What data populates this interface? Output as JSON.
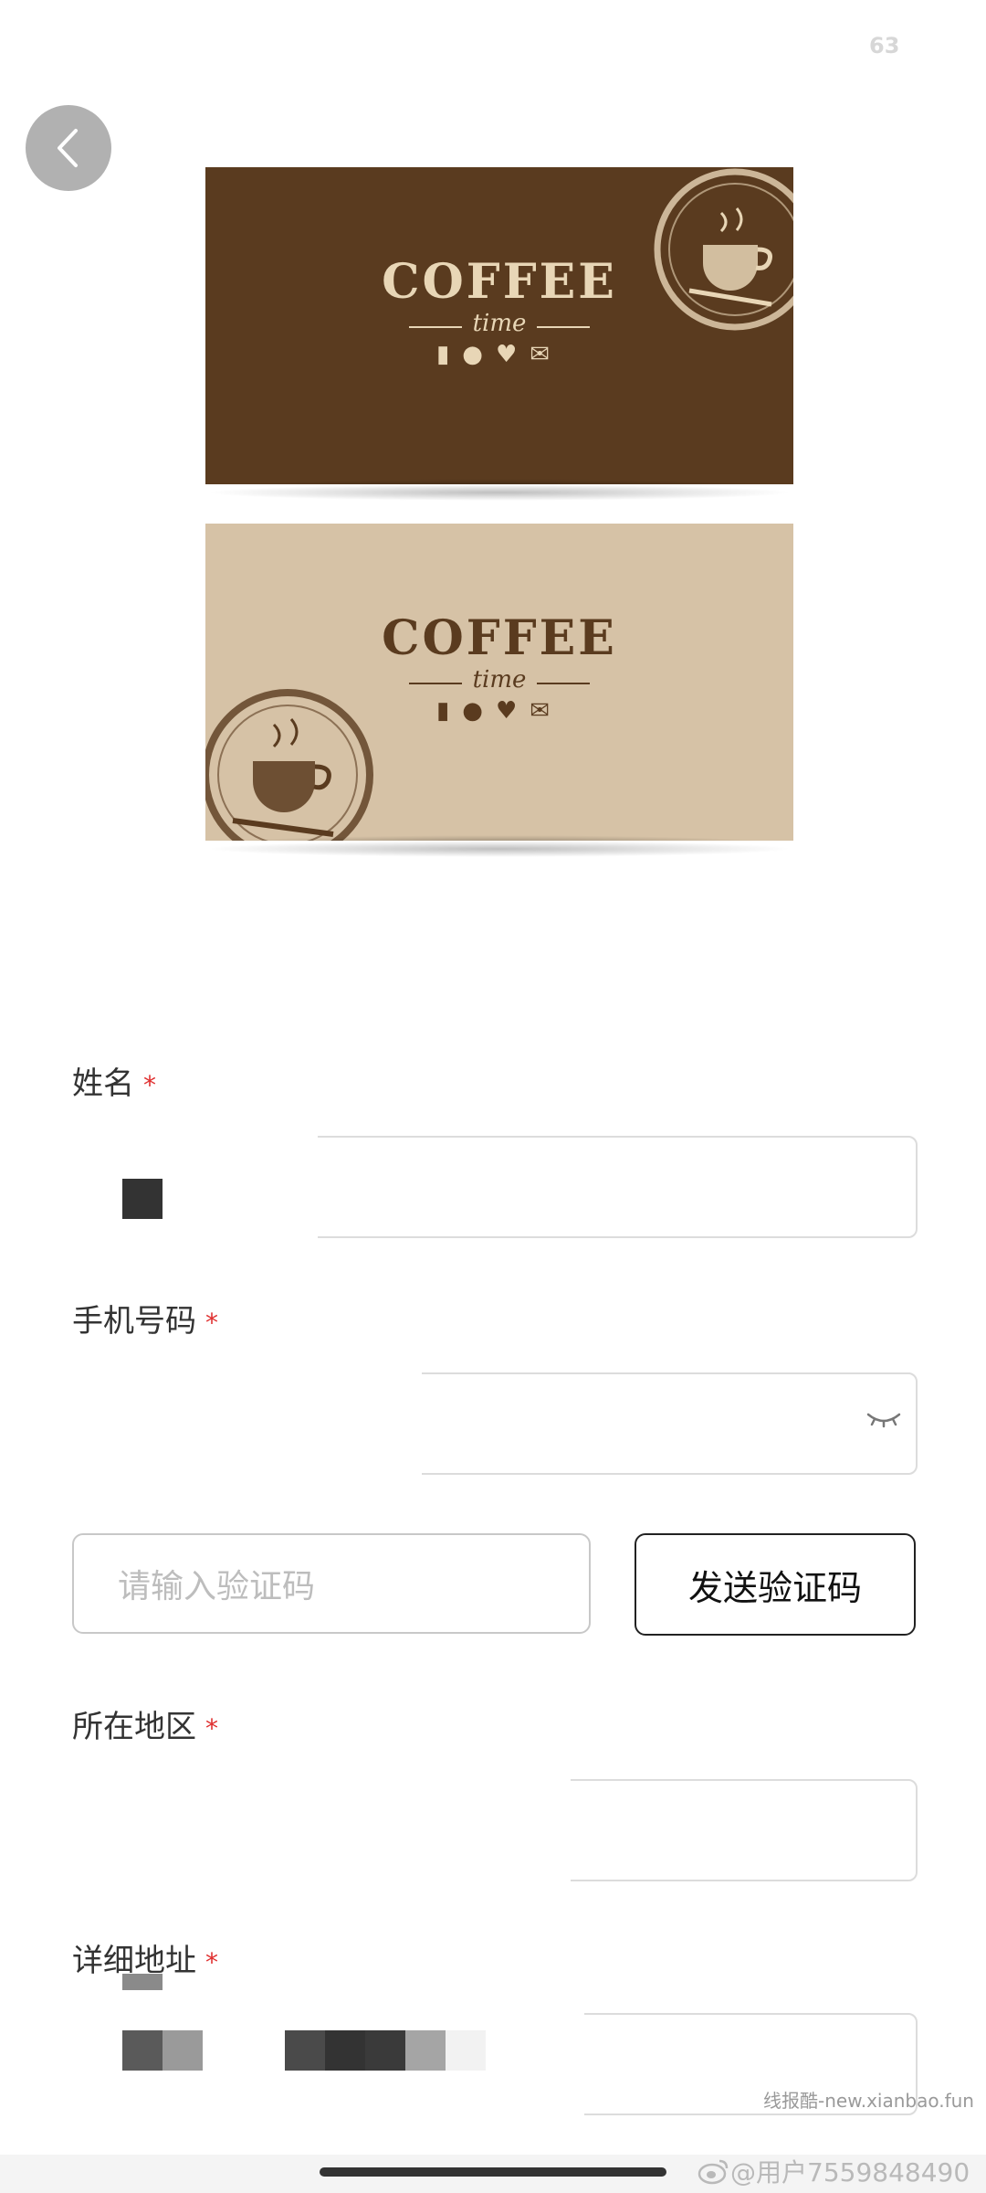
{
  "status": {
    "corner_number": "63"
  },
  "cards": [
    {
      "brand": "COFFEE",
      "sub": "time",
      "icons": [
        "cup-icon",
        "bean-icon",
        "heart-icon",
        "envelope-icon"
      ],
      "bg": "#5a3b1f",
      "fg": "#e8d6b6"
    },
    {
      "brand": "COFFEE",
      "sub": "time",
      "icons": [
        "cup-icon",
        "bean-icon",
        "heart-icon",
        "envelope-icon"
      ],
      "bg": "#d6c2a6",
      "fg": "#5a3b1f"
    }
  ],
  "form": {
    "name": {
      "label": "姓名",
      "required": "*"
    },
    "phone": {
      "label": "手机号码",
      "required": "*"
    },
    "code": {
      "placeholder": "请输入验证码",
      "button": "发送验证码"
    },
    "region": {
      "label": "所在地区",
      "required": "*"
    },
    "address": {
      "label": "详细地址",
      "required": "*"
    }
  },
  "footer": {
    "watermark": "线报酷-new.xianbao.fun",
    "weibo_user": "@用户7559848490"
  },
  "colors": {
    "required": "#e03030",
    "input_border": "#dcdcdc",
    "button_border": "#222222"
  }
}
